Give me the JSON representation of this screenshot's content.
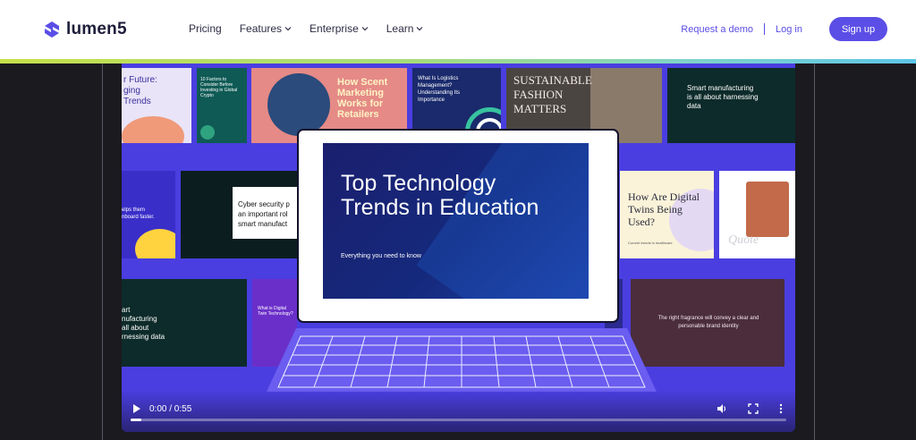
{
  "nav": {
    "brand": "lumen5",
    "menu": [
      {
        "label": "Pricing"
      },
      {
        "label": "Features"
      },
      {
        "label": "Enterprise"
      },
      {
        "label": "Learn"
      }
    ],
    "request_demo": "Request a demo",
    "login": "Log in",
    "signup": "Sign up"
  },
  "video": {
    "tiles": {
      "t1": "r Future:\nging\nTrends",
      "t2": "10 Factors to Consider Before Investing in Global Crypto",
      "t3": "How Scent Marketing Works for Retailers",
      "t4": "What Is Logistics Management? Understanding Its Importance",
      "t5": "SUSTAINABLE FASHION MATTERS",
      "t6": "Smart manufacturing is all about harnessing data",
      "t7": "elps them\nnboard faster.",
      "t8": "Cyber security p\nan important rol\nsmart manufact",
      "t9": "How Are Digital Twins Being Used?",
      "t9b": "Current trends in healthcare",
      "t10": "Quote",
      "t11": "art\nnufacturing\nall about\nrnessing data",
      "t12": "What is Digital Twin Technology?",
      "t13": "all",
      "t14": "The right fragrance will convey a clear and personable brand identity"
    },
    "slide": {
      "title": "Top Technology Trends in Education",
      "subtitle": "Everything you need to know"
    },
    "controls": {
      "time": "0:00 / 0:55",
      "progress": 0.0
    }
  }
}
